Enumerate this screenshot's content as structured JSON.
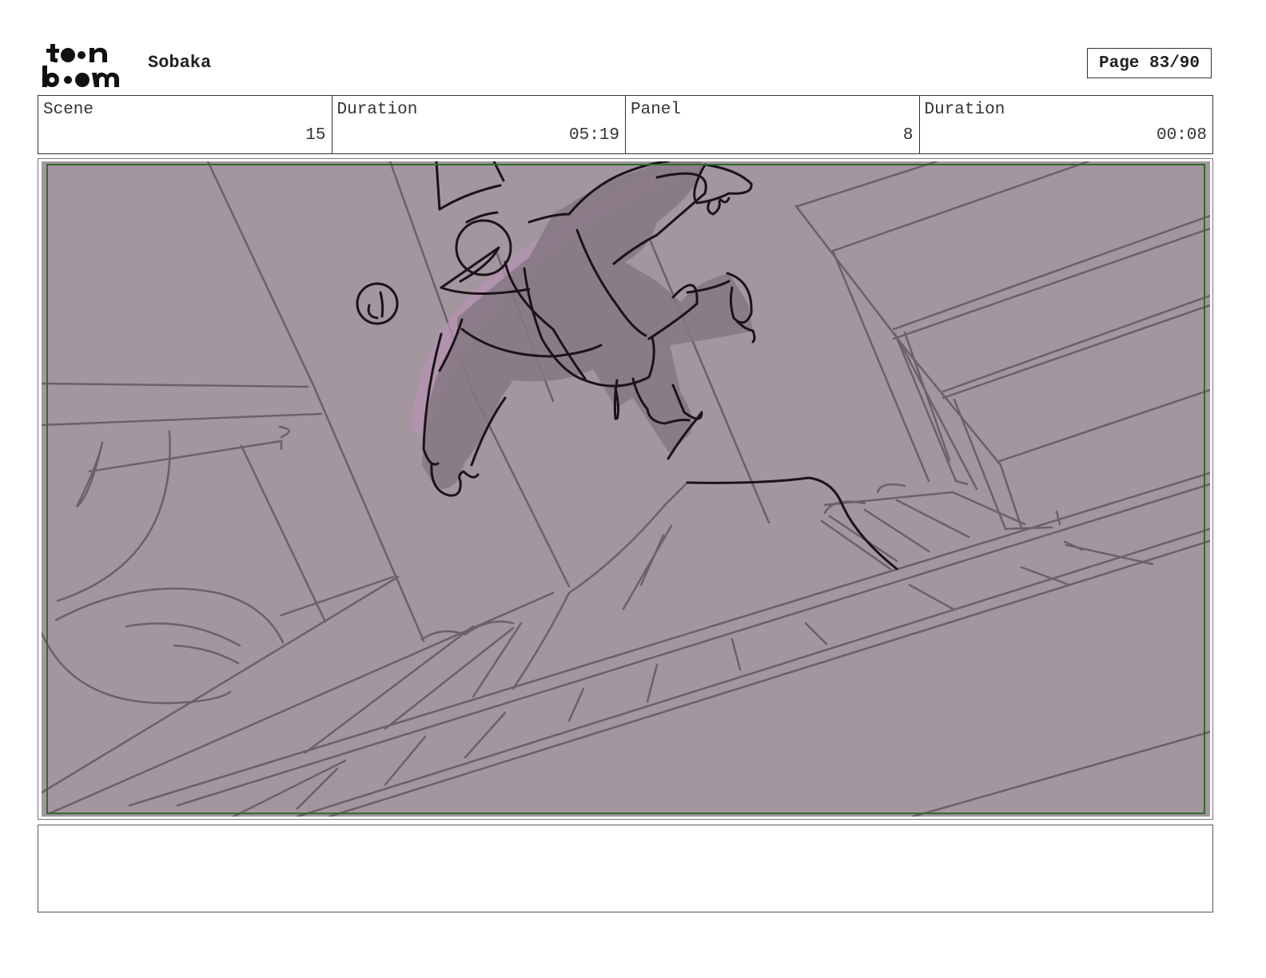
{
  "header": {
    "project_title": "Sobaka",
    "page_label": "Page 83/90",
    "logo_text": "toon boom"
  },
  "info": {
    "scene_label": "Scene",
    "scene_value": "15",
    "scene_duration_label": "Duration",
    "scene_duration_value": "05:19",
    "panel_label": "Panel",
    "panel_value": "8",
    "panel_duration_label": "Duration",
    "panel_duration_value": "00:08"
  },
  "panel": {
    "background_color": "#a3969f",
    "safe_frame_color": "#2f6b2a",
    "sketch_line_color": "#6d6069",
    "ink_color": "#1a1418",
    "character_fill": "#867883",
    "highlight_color": "#b591b3"
  },
  "notes": {
    "text": ""
  }
}
